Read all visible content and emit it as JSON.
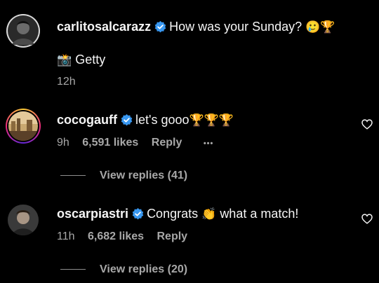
{
  "caption": {
    "username": "carlitosalcarazz",
    "text": "How was your Sunday?",
    "emoji": "🥲🏆",
    "credit_emoji": "📸",
    "credit": "Getty",
    "time": "12h"
  },
  "comments": [
    {
      "username": "cocogauff",
      "text": "let's gooo",
      "emoji": "🏆🏆🏆",
      "time": "9h",
      "likes": "6,591 likes",
      "reply": "Reply",
      "more": "•••",
      "view_replies": "View replies (41)"
    },
    {
      "username": "oscarpiastri",
      "text_before": "Congrats",
      "emoji": "👏",
      "text_after": "what a match!",
      "time": "11h",
      "likes": "6,682 likes",
      "reply": "Reply",
      "view_replies": "View replies (20)"
    }
  ],
  "colors": {
    "background": "#000000",
    "text": "#f5f5f5",
    "secondary": "#a8a8a8",
    "verified": "#3897f0",
    "story_ring": [
      "#f9ce34",
      "#ee2a7b",
      "#6228d7"
    ]
  },
  "icons": [
    "verified-badge-icon",
    "heart-icon",
    "more-options-icon"
  ]
}
